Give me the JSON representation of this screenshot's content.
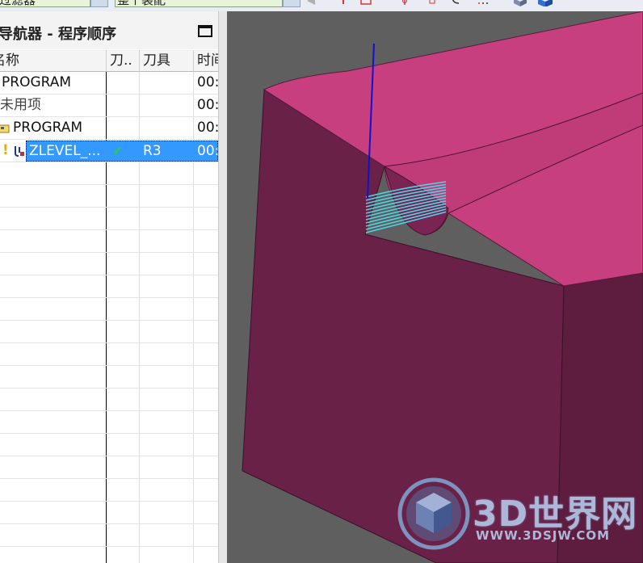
{
  "toolbar": {
    "filter_combo": "过滤器",
    "assembly_combo": "整个装配"
  },
  "navigator": {
    "title": "工序导航器 - 程序顺序",
    "columns": [
      "名称",
      "刀..",
      "刀具",
      "时间"
    ],
    "rows": [
      {
        "name": "PROGRAM",
        "path": "",
        "tool": "",
        "time": "00:"
      },
      {
        "name": "未用项",
        "path": "",
        "tool": "",
        "time": "00:"
      },
      {
        "name": "PROGRAM",
        "path": "",
        "tool": "",
        "time": "00:"
      },
      {
        "name": "ZLEVEL_...",
        "path": "✔",
        "tool": "R3",
        "time": "00:",
        "selected": true
      }
    ]
  },
  "viewport": {
    "colors": {
      "top_face": "#c73f7e",
      "side_face": "#6a2147",
      "toolpath": "#4fd4e6",
      "axis": "#1010d0"
    }
  },
  "watermark": {
    "brand": "3D世界网",
    "url": "WWW.3DSJW.COM"
  }
}
